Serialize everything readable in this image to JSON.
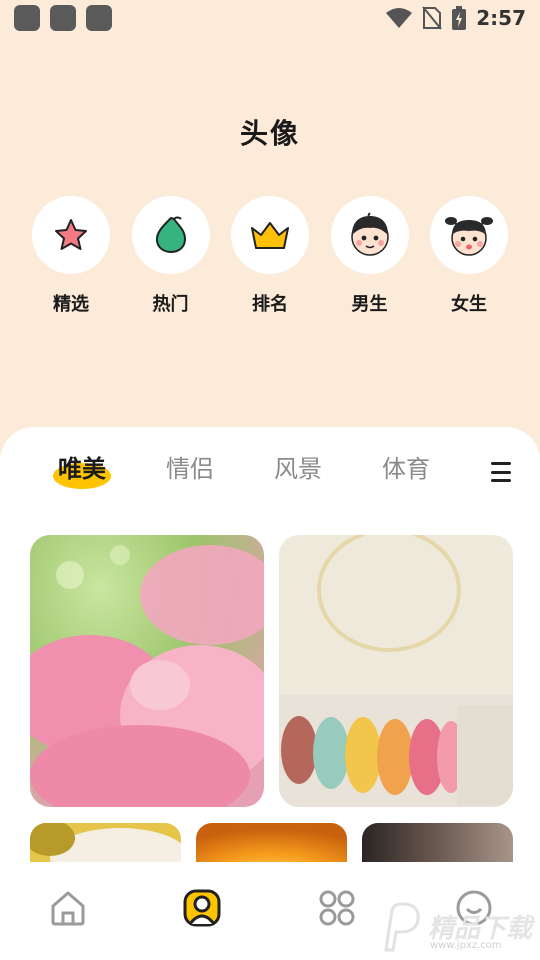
{
  "status_bar": {
    "time": "2:57"
  },
  "header": {
    "title": "头像"
  },
  "categories": [
    {
      "label": "精选",
      "icon": "star-icon"
    },
    {
      "label": "热门",
      "icon": "leaf-icon"
    },
    {
      "label": "排名",
      "icon": "crown-icon"
    },
    {
      "label": "男生",
      "icon": "boy-face-icon"
    },
    {
      "label": "女生",
      "icon": "girl-face-icon"
    }
  ],
  "tabs": [
    {
      "label": "唯美",
      "active": true
    },
    {
      "label": "情侣",
      "active": false
    },
    {
      "label": "风景",
      "active": false
    },
    {
      "label": "体育",
      "active": false
    }
  ],
  "images": [
    {
      "subject": "pink flowers"
    },
    {
      "subject": "macarons"
    },
    {
      "subject": "white flower"
    },
    {
      "subject": "sunset"
    },
    {
      "subject": "portrait"
    }
  ],
  "bottom_nav": [
    {
      "icon": "home-icon",
      "active": false
    },
    {
      "icon": "avatar-icon",
      "active": true
    },
    {
      "icon": "apps-icon",
      "active": false
    },
    {
      "icon": "face-icon",
      "active": false
    }
  ],
  "watermark": {
    "text": "精品下载",
    "url": "www.jpxz.com"
  },
  "colors": {
    "background": "#fdebd9",
    "accent": "#ffc400",
    "panel": "#ffffff"
  }
}
